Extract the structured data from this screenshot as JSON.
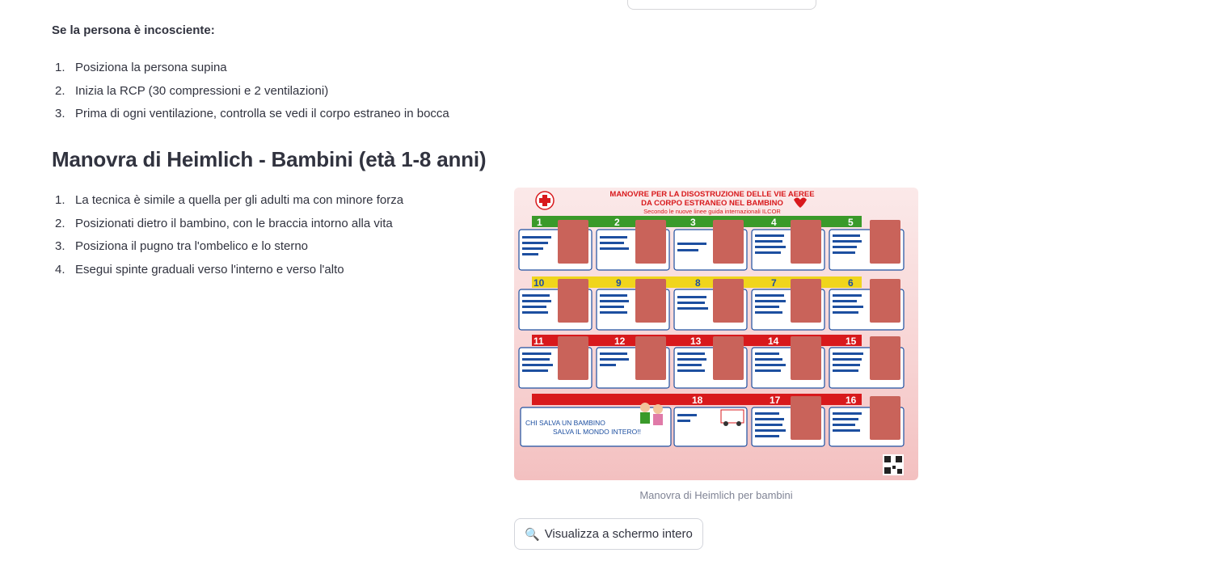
{
  "section_unconscious": {
    "title": "Se la persona è incosciente:",
    "steps": [
      "Posiziona la persona supina",
      "Inizia la RCP (30 compressioni e 2 ventilazioni)",
      "Prima di ogni ventilazione, controlla se vedi il corpo estraneo in bocca"
    ]
  },
  "section_children": {
    "heading": "Manovra di Heimlich - Bambini (età 1-8 anni)",
    "steps": [
      "La tecnica è simile a quella per gli adulti ma con minore forza",
      "Posizionati dietro il bambino, con le braccia intorno alla vita",
      "Posiziona il pugno tra l'ombelico e lo sterno",
      "Esegui spinte graduali verso l'interno e verso l'alto"
    ]
  },
  "poster": {
    "title_line1": "MANOVRE PER LA DISOSTRUZIONE DELLE VIE AEREE",
    "title_line2": "DA CORPO ESTRANEO NEL BAMBINO",
    "subtitle": "Secondo le nuove linee guida internazionali ILCOR",
    "row1_numbers": [
      "1",
      "2",
      "3",
      "4",
      "5"
    ],
    "row2_numbers": [
      "10",
      "9",
      "8",
      "7",
      "6"
    ],
    "row3_numbers": [
      "11",
      "12",
      "13",
      "14",
      "15"
    ],
    "row4_numbers": [
      "18",
      "17",
      "16"
    ],
    "slogan_line1": "CHI SALVA UN BAMBINO",
    "slogan_line2": "SALVA IL MONDO INTERO!!",
    "colors": {
      "green": "#3a9a2a",
      "yellow": "#f0d51c",
      "red": "#d8191c",
      "blue": "#1d4fa0"
    }
  },
  "image_caption": "Manovra di Heimlich per bambini",
  "fullscreen_button": {
    "icon": "magnifier-icon",
    "label": "Visualizza a schermo intero"
  }
}
